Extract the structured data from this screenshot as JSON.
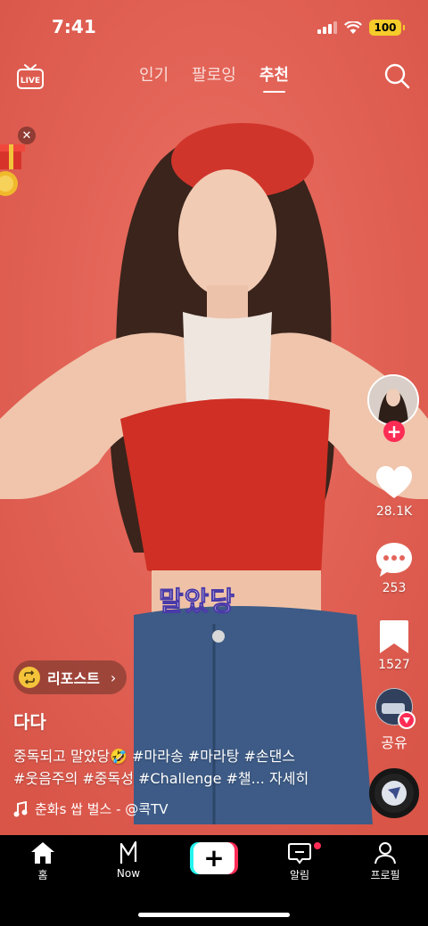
{
  "status": {
    "time": "7:41",
    "battery": "100"
  },
  "topnav": {
    "live_label": "LIVE",
    "tabs": [
      {
        "label": "인기",
        "active": false
      },
      {
        "label": "팔로잉",
        "active": false
      },
      {
        "label": "추천",
        "active": true
      }
    ]
  },
  "video": {
    "subtitle": "말았당"
  },
  "rail": {
    "likes": "28.1K",
    "comments": "253",
    "saves": "1527",
    "share_label": "공유"
  },
  "repost": {
    "label": "리포스트"
  },
  "post": {
    "author": "다다",
    "caption_line1": "중독되고 말았당🤣 #마라송 #마라탕 #손댄스",
    "caption_line2": "#웃음주의 #중독성 #Challenge #챌...",
    "more_label": "자세히",
    "music": "춘화s 쌉 벌스 - @콕TV"
  },
  "tabbar": {
    "items": [
      {
        "label": "홈",
        "icon": "home-icon"
      },
      {
        "label": "Now",
        "icon": "now-icon"
      },
      {
        "label": "",
        "icon": "create-plus-icon"
      },
      {
        "label": "알림",
        "icon": "inbox-icon"
      },
      {
        "label": "프로필",
        "icon": "profile-icon"
      }
    ]
  },
  "colors": {
    "accent": "#fe2c55",
    "cyan": "#25f4ee",
    "background": "#e4645a"
  }
}
